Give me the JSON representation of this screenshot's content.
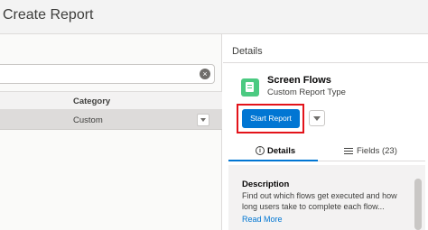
{
  "header": {
    "title": "Create Report"
  },
  "left": {
    "table": {
      "column_category": "Category",
      "rows": [
        {
          "category": "Custom"
        }
      ]
    }
  },
  "details": {
    "panel_title": "Details",
    "report_type": {
      "title": "Screen Flows",
      "subtitle": "Custom Report Type",
      "icon": "flow-icon",
      "icon_color": "#4bca81"
    },
    "start_button": "Start Report",
    "tabs": {
      "details": "Details",
      "fields": "Fields (23)"
    },
    "description": {
      "heading": "Description",
      "text": "Find out which flows get executed and how long users take to complete each flow...",
      "read_more": "Read More"
    }
  },
  "colors": {
    "accent": "#0176d3",
    "highlight": "#e3131a"
  }
}
